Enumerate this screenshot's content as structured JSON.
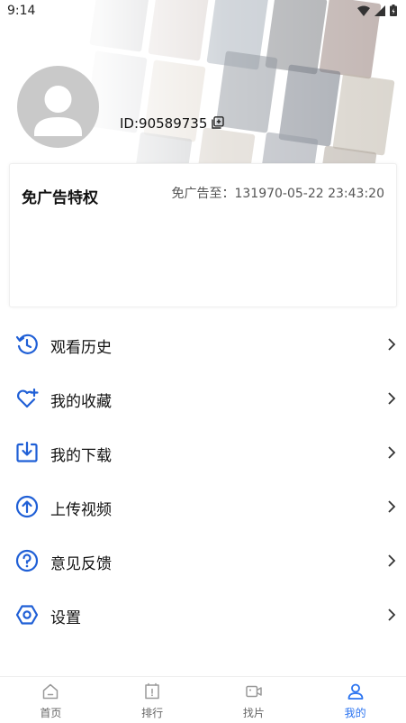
{
  "status_bar": {
    "time": "9:14"
  },
  "profile": {
    "id_text": "ID:90589735"
  },
  "vip_card": {
    "title": "免广告特权",
    "expire_text": "免广告至：131970-05-22 23:43:20"
  },
  "menu": {
    "items": [
      {
        "label": "观看历史",
        "icon": "history-icon"
      },
      {
        "label": "我的收藏",
        "icon": "heart-plus-icon"
      },
      {
        "label": "我的下载",
        "icon": "download-icon"
      },
      {
        "label": "上传视频",
        "icon": "upload-icon"
      },
      {
        "label": "意见反馈",
        "icon": "question-icon"
      },
      {
        "label": "设置",
        "icon": "settings-icon"
      }
    ]
  },
  "bottom_nav": {
    "items": [
      {
        "label": "首页",
        "icon": "home-icon",
        "active": false
      },
      {
        "label": "排行",
        "icon": "ranking-icon",
        "active": false
      },
      {
        "label": "找片",
        "icon": "video-camera-icon",
        "active": false
      },
      {
        "label": "我的",
        "icon": "person-icon",
        "active": true
      }
    ]
  },
  "colors": {
    "accent": "#2a73f0",
    "icon_blue": "#1f5fd6",
    "avatar_bg": "#c9c9c9"
  }
}
